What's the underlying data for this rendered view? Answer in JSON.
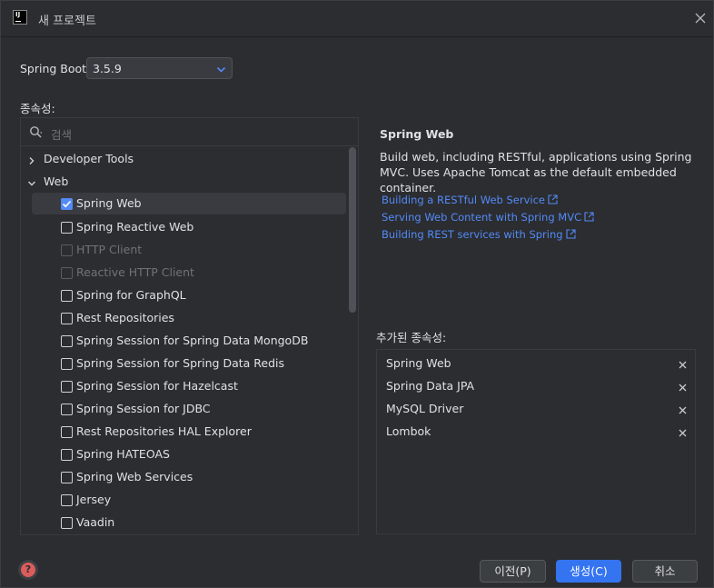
{
  "window": {
    "title": "새 프로젝트",
    "app_icon": "intellij-idea-icon",
    "app_icon_letters": "IJ"
  },
  "spring_boot": {
    "label": "Spring Boot:",
    "version": "3.5.9"
  },
  "dependencies": {
    "label": "종속성:",
    "search_placeholder": "검색",
    "tree": [
      {
        "type": "category",
        "label": "Developer Tools",
        "expanded": false
      },
      {
        "type": "category",
        "label": "Web",
        "expanded": true
      },
      {
        "type": "item",
        "label": "Spring Web",
        "checked": true,
        "disabled": false,
        "selected": true
      },
      {
        "type": "item",
        "label": "Spring Reactive Web",
        "checked": false,
        "disabled": false
      },
      {
        "type": "item",
        "label": "HTTP Client",
        "checked": false,
        "disabled": true
      },
      {
        "type": "item",
        "label": "Reactive HTTP Client",
        "checked": false,
        "disabled": true
      },
      {
        "type": "item",
        "label": "Spring for GraphQL",
        "checked": false,
        "disabled": false
      },
      {
        "type": "item",
        "label": "Rest Repositories",
        "checked": false,
        "disabled": false
      },
      {
        "type": "item",
        "label": "Spring Session for Spring Data MongoDB",
        "checked": false,
        "disabled": false
      },
      {
        "type": "item",
        "label": "Spring Session for Spring Data Redis",
        "checked": false,
        "disabled": false
      },
      {
        "type": "item",
        "label": "Spring Session for Hazelcast",
        "checked": false,
        "disabled": false
      },
      {
        "type": "item",
        "label": "Spring Session for JDBC",
        "checked": false,
        "disabled": false
      },
      {
        "type": "item",
        "label": "Rest Repositories HAL Explorer",
        "checked": false,
        "disabled": false
      },
      {
        "type": "item",
        "label": "Spring HATEOAS",
        "checked": false,
        "disabled": false
      },
      {
        "type": "item",
        "label": "Spring Web Services",
        "checked": false,
        "disabled": false
      },
      {
        "type": "item",
        "label": "Jersey",
        "checked": false,
        "disabled": false
      },
      {
        "type": "item",
        "label": "Vaadin",
        "checked": false,
        "disabled": false
      }
    ]
  },
  "detail": {
    "title": "Spring Web",
    "description": "Build web, including RESTful, applications using Spring MVC. Uses Apache Tomcat as the default embedded container.",
    "links": [
      "Building a RESTful Web Service",
      "Serving Web Content with Spring MVC",
      "Building REST services with Spring"
    ]
  },
  "added": {
    "label": "추가된 종속성:",
    "items": [
      "Spring Web",
      "Spring Data JPA",
      "MySQL Driver",
      "Lombok"
    ]
  },
  "buttons": {
    "prev": "이전(P)",
    "create": "생성(C)",
    "cancel": "취소"
  },
  "colors": {
    "accent": "#3574f0",
    "link": "#548af7",
    "background": "#2b2d30"
  }
}
